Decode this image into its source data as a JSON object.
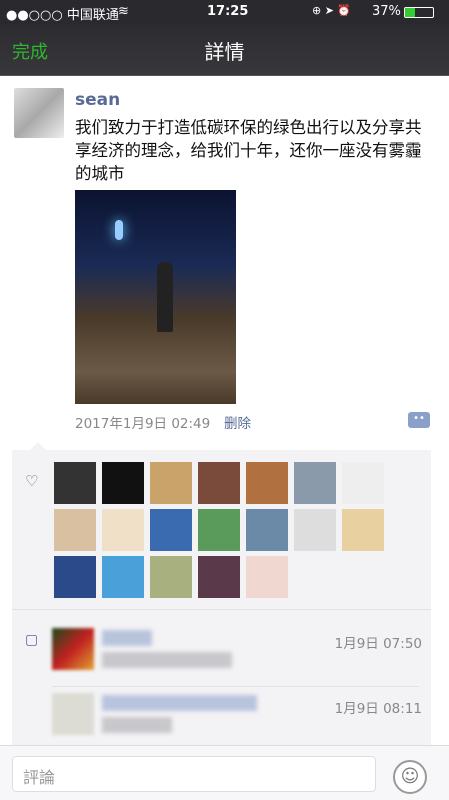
{
  "status_bar": {
    "carrier": "●●○○○ 中国联通",
    "wifi": "wifi-icon",
    "time": "17:25",
    "icons": "⊕ ➤ ⏰",
    "battery": "37%"
  },
  "nav": {
    "back_label": "完成",
    "title": "詳情"
  },
  "post": {
    "author": "sean",
    "text": "我们致力于打造低碳环保的绿色出行以及分享共享经济的理念，给我们十年，还你一座没有雾霾的城市",
    "timestamp": "2017年1月9日 02:49",
    "delete_label": "删除"
  },
  "likes": {
    "colors": [
      "#333",
      "#111",
      "#c9a36a",
      "#7a4a3a",
      "#b07040",
      "#8a9aaa",
      "#eee",
      "#d8c0a0",
      "#f0e0c8",
      "#3a6ab0",
      "#5a9a5a",
      "#6a8aa8",
      "#ddd",
      "#e8d0a0",
      "#2a4a8a",
      "#4aa0d8",
      "#a8b080",
      "#5a3a4a",
      "#f0d8d0"
    ]
  },
  "comments": [
    {
      "time": "1月9日 07:50",
      "avatar_color": "#6a2a20"
    },
    {
      "time": "1月9日 08:11",
      "avatar_color": "#d8d8d0"
    }
  ],
  "comment_bar": {
    "placeholder": "評論"
  }
}
